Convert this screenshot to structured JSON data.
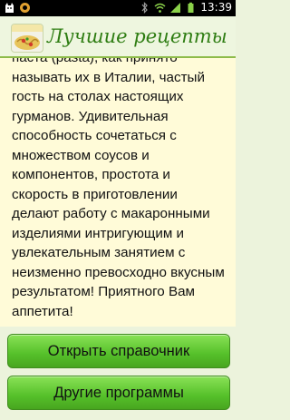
{
  "statusbar": {
    "time": "13:39",
    "icons": [
      "cat-icon",
      "settings-icon",
      "bluetooth-icon",
      "wifi-icon",
      "signal-icon",
      "battery-icon"
    ]
  },
  "header": {
    "title": "Лучшие рецепты",
    "logo_icon": "pasta-logo-icon"
  },
  "content": {
    "text": "паста (pasta), как принято называть их в Италии, частый гость на столах настоящих гурманов. Удивительная способность сочетаться с множеством соусов и компонентов, простота и скорость в приготовлении делают работу с макаронными изделиями интригующим и увлекательным занятием с неизменно превосходно вкусным результатом! Приятного Вам аппетита!"
  },
  "buttons": {
    "open_reference": "Открыть справочник",
    "other_programs": "Другие программы"
  },
  "colors": {
    "header_title": "#2e7d12",
    "button_green": "#55c02a",
    "content_bg": "#fffbd8"
  }
}
